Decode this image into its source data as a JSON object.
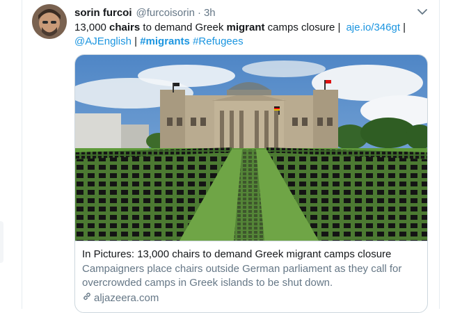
{
  "tweet": {
    "author_name": "sorin furcoi",
    "author_handle": "@furcoisorin",
    "separator": "·",
    "time": "3h",
    "text": {
      "p1": "13,000 ",
      "bold1": "chairs",
      "p2": " to demand Greek ",
      "bold2": "migrant",
      "p3": " camps closure |",
      "link_url": "aje.io/346gt",
      "p4": " |",
      "mention": "@AJEnglish",
      "p5": " |",
      "hashtag1": "#migrants",
      "hashtag2": "#Refugees"
    }
  },
  "card": {
    "title": "In Pictures: 13,000 chairs to demand Greek migrant camps closure",
    "description": "Campaigners place chairs outside German parliament as they call for overcrowded camps in Greek islands to be shut down.",
    "domain": "aljazeera.com"
  },
  "icons": {
    "more": "chevron-down-icon",
    "link": "link-icon"
  },
  "colors": {
    "link": "#1b95e0",
    "text": "#14171a",
    "muted": "#657786",
    "border": "#ccd6dd"
  }
}
